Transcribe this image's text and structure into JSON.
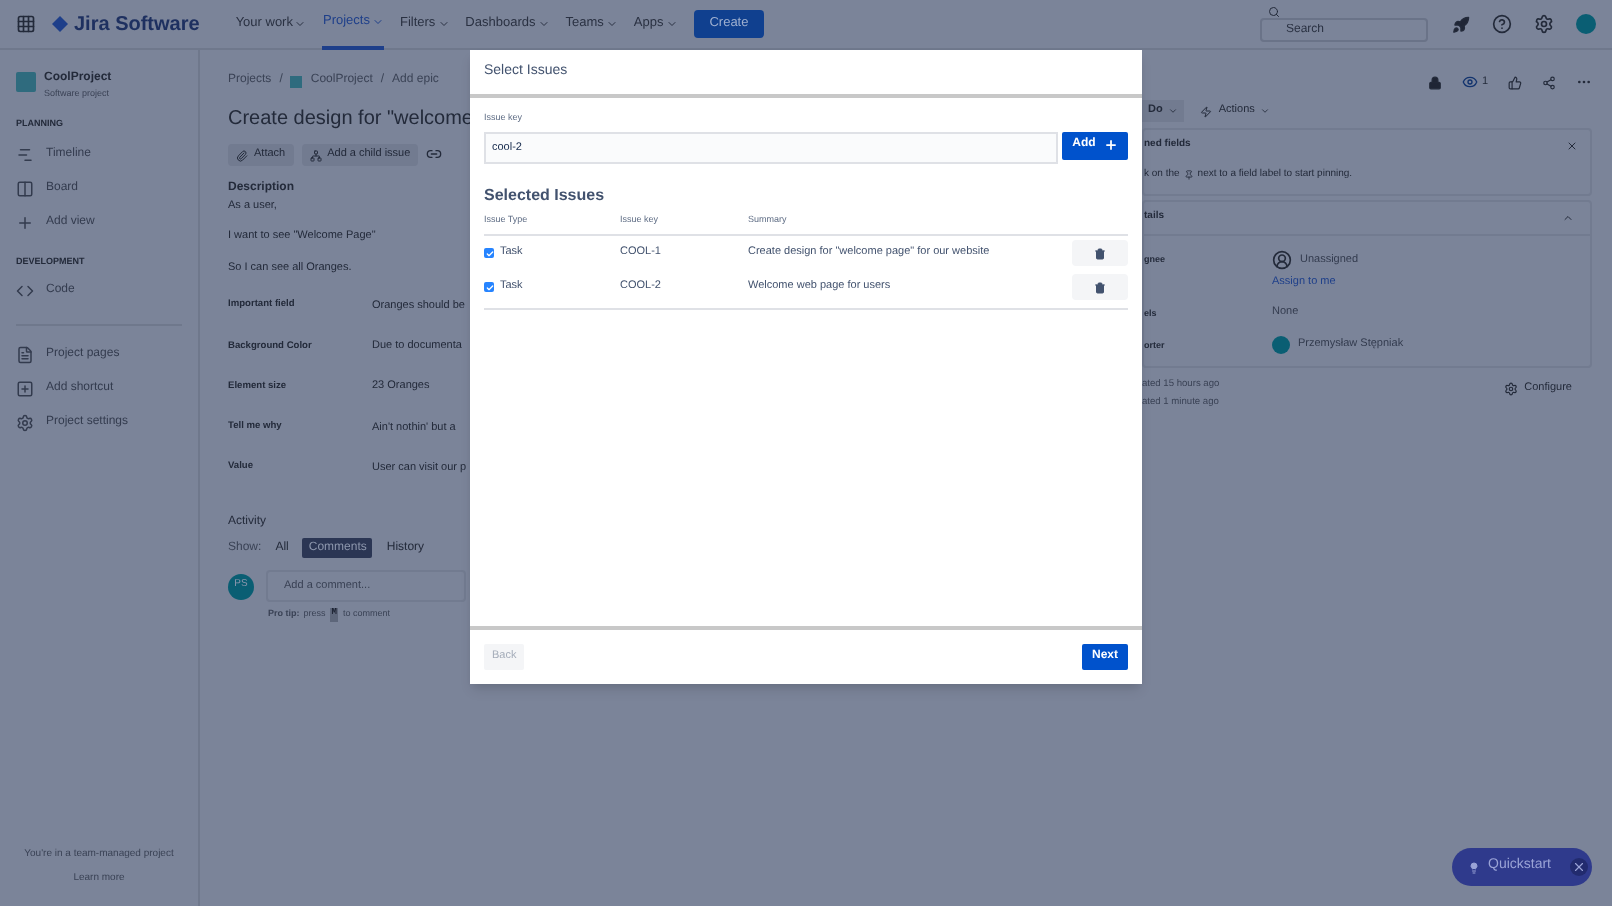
{
  "top_nav": {
    "logo": "Jira Software",
    "items": [
      {
        "label": "Your work",
        "selected": false
      },
      {
        "label": "Projects",
        "selected": true
      },
      {
        "label": "Filters",
        "selected": false
      },
      {
        "label": "Dashboards",
        "selected": false
      },
      {
        "label": "Teams",
        "selected": false
      },
      {
        "label": "Apps",
        "selected": false
      }
    ],
    "create": "Create",
    "search": {
      "placeholder": "Search"
    }
  },
  "sidebar": {
    "project": "CoolProject",
    "project_type": "Software project",
    "sections": [
      {
        "heading": "PLANNING",
        "items": [
          {
            "kind": "timeline",
            "label": "Timeline"
          },
          {
            "kind": "board",
            "label": "Board"
          },
          {
            "kind": "add",
            "label": "Add view"
          }
        ]
      },
      {
        "heading": "DEVELOPMENT",
        "items": [
          {
            "kind": "code",
            "label": "Code"
          }
        ]
      },
      {
        "items": [
          {
            "kind": "pages",
            "label": "Project pages"
          },
          {
            "kind": "shortcut",
            "label": "Add shortcut"
          },
          {
            "kind": "settings",
            "label": "Project settings"
          }
        ]
      }
    ],
    "footer": "You're in a team-managed project",
    "learn_more": "Learn more"
  },
  "issue": {
    "breadcrumbs": [
      "Projects",
      "/",
      "CoolProject",
      "/",
      "Add epic"
    ],
    "title": "Create design for \"welcome",
    "actions": [
      "Attach",
      "Add a child issue"
    ],
    "description_heading": "Description",
    "description": [
      "As a user,",
      "I want to see \"Welcome Page\"",
      "So I can see all Oranges."
    ],
    "fields": [
      {
        "label": "Important field",
        "value": "Oranges should be"
      },
      {
        "label": "Background Color",
        "value": "Due to documenta"
      },
      {
        "label": "Element size",
        "value": "23 Oranges"
      },
      {
        "label": "Tell me why",
        "value": "Ain't nothin' but a"
      },
      {
        "label": "Value",
        "value": "User can visit our p"
      }
    ],
    "activity": {
      "heading": "Activity",
      "show": "Show:",
      "tabs": [
        {
          "label": "All",
          "selected": false
        },
        {
          "label": "Comments",
          "selected": true
        },
        {
          "label": "History",
          "selected": false
        }
      ],
      "avatar": "PS",
      "comment_placeholder": "Add a comment...",
      "tip_bold": "Pro tip:",
      "tip_press": "press",
      "tip_key": "M",
      "tip_end": "to comment"
    }
  },
  "right_panel": {
    "watchers": "1",
    "status": "Do",
    "actions": "Actions",
    "pinned_title": "ned fields",
    "pinned_text_start": "k on the",
    "pinned_text_end": "next to a field label to start pinning.",
    "details_title": "tails",
    "details": [
      {
        "label": "gnee",
        "value": "Unassigned",
        "link": "Assign to me",
        "kind": "empty-avatar"
      },
      {
        "label": "els",
        "value": "None",
        "kind": "plain"
      },
      {
        "label": "orter",
        "value": "Przemysław Stępniak",
        "kind": "avatar"
      }
    ],
    "created": "ated 15 hours ago",
    "updated": "ated 1 minute ago",
    "configure": "Configure"
  },
  "modal": {
    "title": "Select Issues",
    "key_label": "Issue key",
    "key_value": "cool-2",
    "add": "Add",
    "section": "Selected Issues",
    "columns": [
      "Issue Type",
      "Issue key",
      "Summary"
    ],
    "rows": [
      {
        "checked": true,
        "type": "Task",
        "key": "COOL-1",
        "summary": "Create design for \"welcome page\" for our website"
      },
      {
        "checked": true,
        "type": "Task",
        "key": "COOL-2",
        "summary": "Welcome web page for users"
      }
    ],
    "back": {
      "label": "Back",
      "disabled": true
    },
    "next": "Next"
  },
  "quickstart": "Quickstart"
}
